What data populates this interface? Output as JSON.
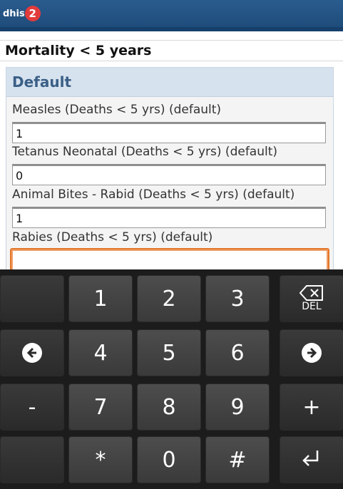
{
  "header": {
    "logo_text": "dhis",
    "logo_badge": "2"
  },
  "page": {
    "title": "Mortality < 5 years"
  },
  "section": {
    "title": "Default"
  },
  "fields": [
    {
      "label": "Measles (Deaths < 5 yrs) (default)",
      "value": "1"
    },
    {
      "label": "Tetanus Neonatal (Deaths < 5 yrs) (default)",
      "value": "0"
    },
    {
      "label": "Animal Bites - Rabid (Deaths < 5 yrs) (default)",
      "value": "1"
    },
    {
      "label": "Rabies (Deaths < 5 yrs) (default)",
      "value": ""
    }
  ],
  "keyboard": {
    "row1": [
      "",
      "1",
      "2",
      "3",
      "DEL"
    ],
    "row2": [
      "left-arrow",
      "4",
      "5",
      "6",
      "right-arrow"
    ],
    "row3": [
      "-",
      "7",
      "8",
      "9",
      "+"
    ],
    "row4": [
      "",
      "*",
      "0",
      "#",
      "enter"
    ]
  }
}
